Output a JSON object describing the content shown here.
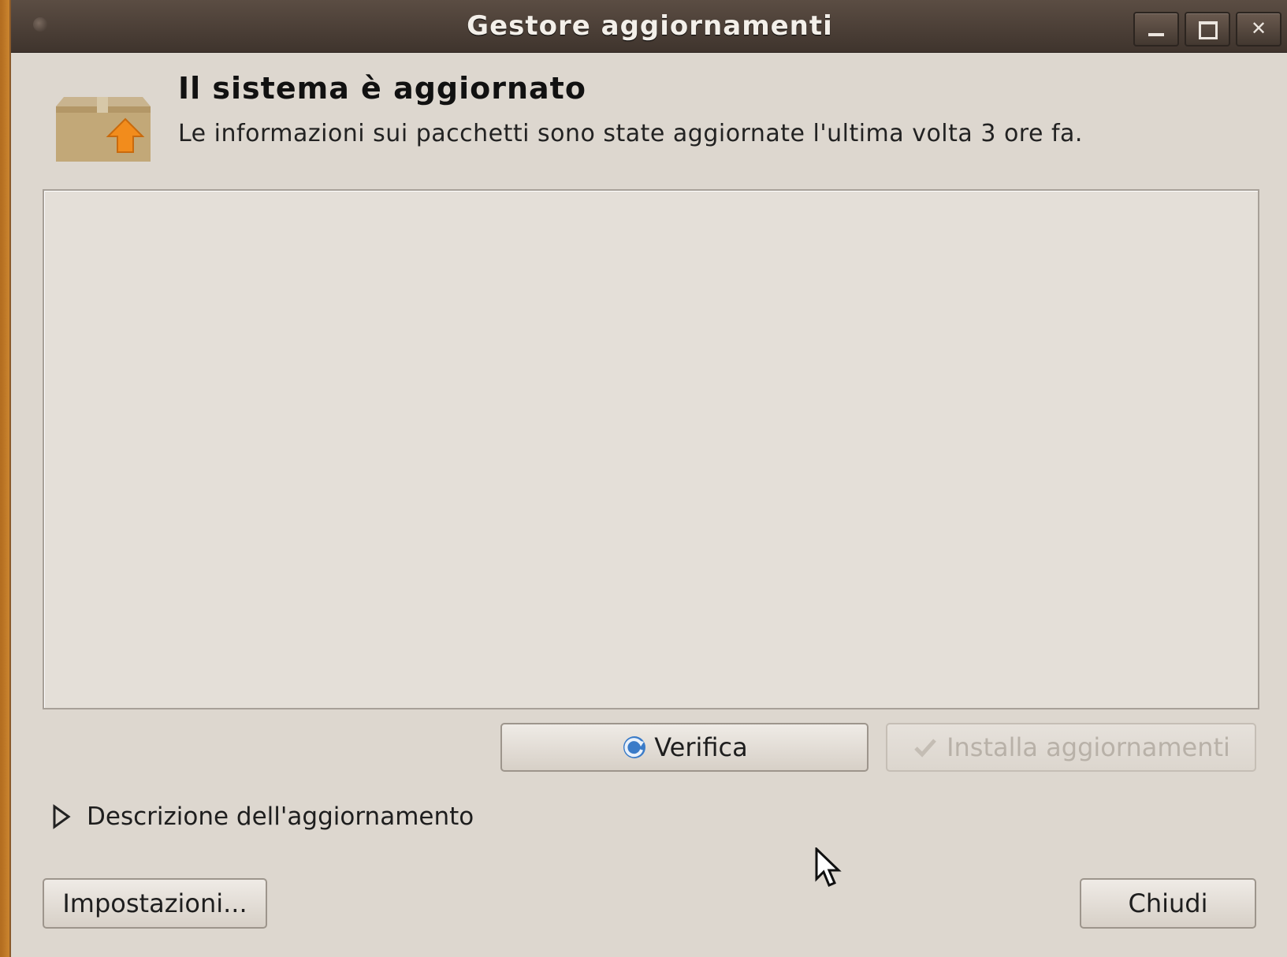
{
  "window": {
    "title": "Gestore aggiornamenti",
    "controls": [
      "minimize-icon",
      "maximize-icon",
      "close-icon"
    ]
  },
  "status": {
    "heading": "Il sistema è aggiornato",
    "message": "Le informazioni sui pacchetti sono state aggiornate l'ultima volta 3 ore fa.",
    "icon": "package-update-icon"
  },
  "update_list": {
    "items": []
  },
  "actions": {
    "check_label": "Verifica",
    "check_icon": "refresh-icon",
    "install_label": "Installa aggiornamenti",
    "install_icon": "check-icon",
    "install_enabled": false
  },
  "details": {
    "expander_label": "Descrizione dell'aggiornamento",
    "expanded": false
  },
  "footer": {
    "settings_label": "Impostazioni...",
    "close_label": "Chiudi"
  },
  "colors": {
    "titlebar": "#4a3e36",
    "window_bg": "#ddd7cf",
    "desktop_accent": "#d08a32"
  }
}
